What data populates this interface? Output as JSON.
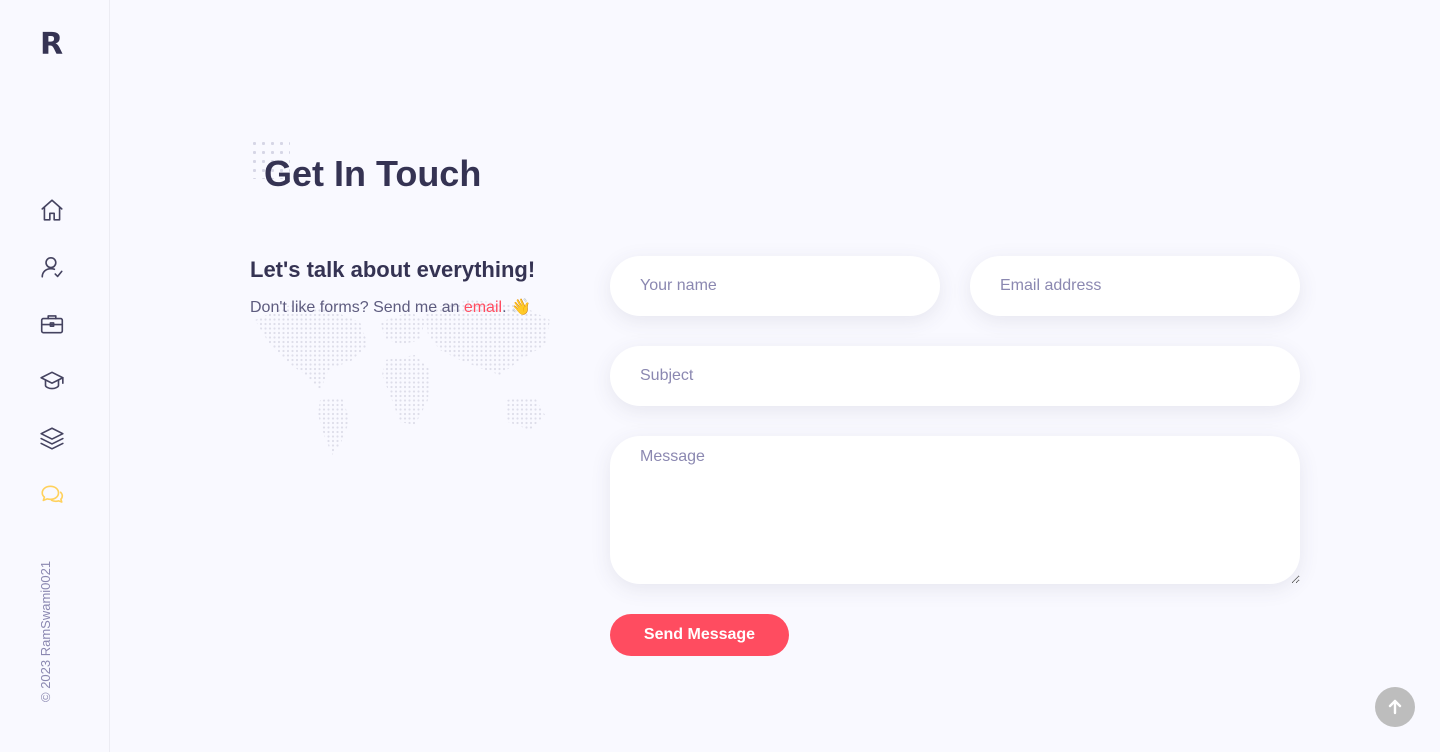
{
  "sidebar": {
    "logo": "R",
    "nav_items": [
      {
        "icon": "home-icon"
      },
      {
        "icon": "user-check-icon"
      },
      {
        "icon": "briefcase-icon"
      },
      {
        "icon": "graduation-cap-icon"
      },
      {
        "icon": "layers-icon"
      },
      {
        "icon": "chat-bubbles-icon",
        "active": true
      }
    ],
    "copyright": "© 2023 RamSwami0021"
  },
  "section": {
    "title": "Get In Touch"
  },
  "intro": {
    "heading": "Let's talk about everything!",
    "text_before": "Don't like forms? Send me an ",
    "link": "email",
    "text_after": ". 👋"
  },
  "form": {
    "name_placeholder": "Your name",
    "email_placeholder": "Email address",
    "subject_placeholder": "Subject",
    "message_placeholder": "Message",
    "submit_label": "Send Message"
  },
  "colors": {
    "accent": "#ff4c60",
    "active_nav": "#ffd15c",
    "text": "#353353",
    "background": "#f9f9ff"
  }
}
